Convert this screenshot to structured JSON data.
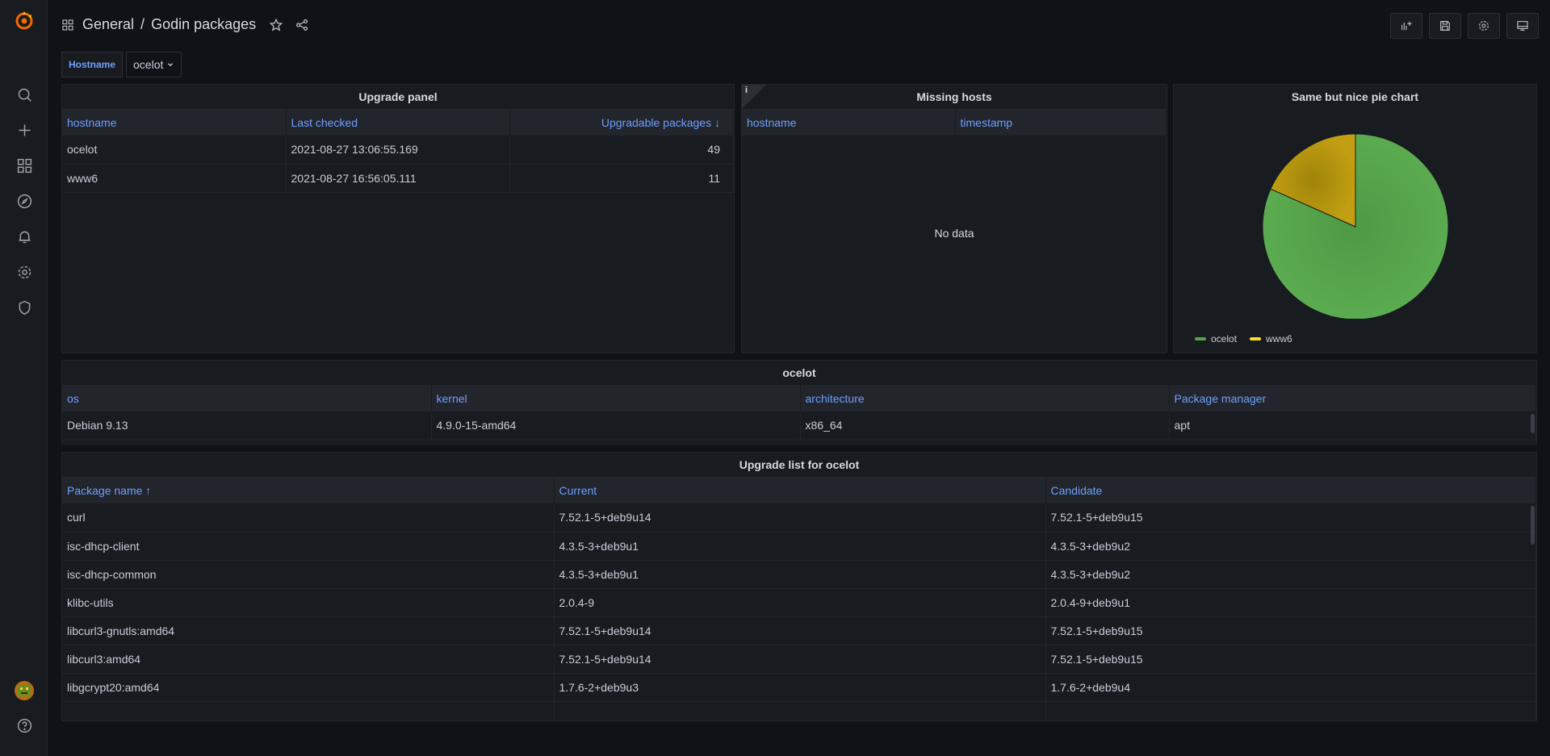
{
  "breadcrumb": {
    "folder": "General",
    "separator": "/",
    "title": "Godin packages"
  },
  "variables": {
    "hostname_label": "Hostname",
    "hostname_value": "ocelot"
  },
  "icons": {
    "sidebar": [
      "grafana-logo-icon",
      "search-icon",
      "plus-icon",
      "dashboards-icon",
      "explore-icon",
      "alerting-icon",
      "gear-icon",
      "shield-icon",
      "avatar",
      "help-icon"
    ],
    "header": [
      "star-icon",
      "share-icon",
      "add-panel-icon",
      "save-icon",
      "settings-icon",
      "tv-mode-icon"
    ]
  },
  "colors": {
    "accent": "#6e9fff",
    "ocelot": "#56a64b",
    "www6": "#b7980f"
  },
  "upgrade_panel": {
    "title": "Upgrade panel",
    "columns": [
      "hostname",
      "Last checked",
      "Upgradable packages ↓"
    ],
    "rows": [
      [
        "ocelot",
        "2021-08-27 13:06:55.169",
        "49"
      ],
      [
        "www6",
        "2021-08-27 16:56:05.111",
        "11"
      ]
    ]
  },
  "missing_hosts": {
    "title": "Missing hosts",
    "info": "i",
    "columns": [
      "hostname",
      "timestamp"
    ],
    "empty_text": "No data"
  },
  "pie_panel": {
    "title": "Same but nice pie chart",
    "legend": [
      "ocelot",
      "www6"
    ]
  },
  "chart_data": {
    "type": "pie",
    "title": "Same but nice pie chart",
    "categories": [
      "ocelot",
      "www6"
    ],
    "values": [
      49,
      11
    ],
    "colors": [
      "#56a64b",
      "#b7980f"
    ],
    "legend_position": "bottom-left"
  },
  "host_panel": {
    "title": "ocelot",
    "columns": [
      "os",
      "kernel",
      "architecture",
      "Package manager"
    ],
    "rows": [
      [
        "Debian 9.13",
        "4.9.0-15-amd64",
        "x86_64",
        "apt"
      ]
    ]
  },
  "upgrade_list": {
    "title": "Upgrade list for ocelot",
    "columns": [
      "Package name ↑",
      "Current",
      "Candidate"
    ],
    "rows": [
      [
        "curl",
        "7.52.1-5+deb9u14",
        "7.52.1-5+deb9u15"
      ],
      [
        "isc-dhcp-client",
        "4.3.5-3+deb9u1",
        "4.3.5-3+deb9u2"
      ],
      [
        "isc-dhcp-common",
        "4.3.5-3+deb9u1",
        "4.3.5-3+deb9u2"
      ],
      [
        "klibc-utils",
        "2.0.4-9",
        "2.0.4-9+deb9u1"
      ],
      [
        "libcurl3-gnutls:amd64",
        "7.52.1-5+deb9u14",
        "7.52.1-5+deb9u15"
      ],
      [
        "libcurl3:amd64",
        "7.52.1-5+deb9u14",
        "7.52.1-5+deb9u15"
      ],
      [
        "libgcrypt20:amd64",
        "1.7.6-2+deb9u3",
        "1.7.6-2+deb9u4"
      ]
    ]
  }
}
